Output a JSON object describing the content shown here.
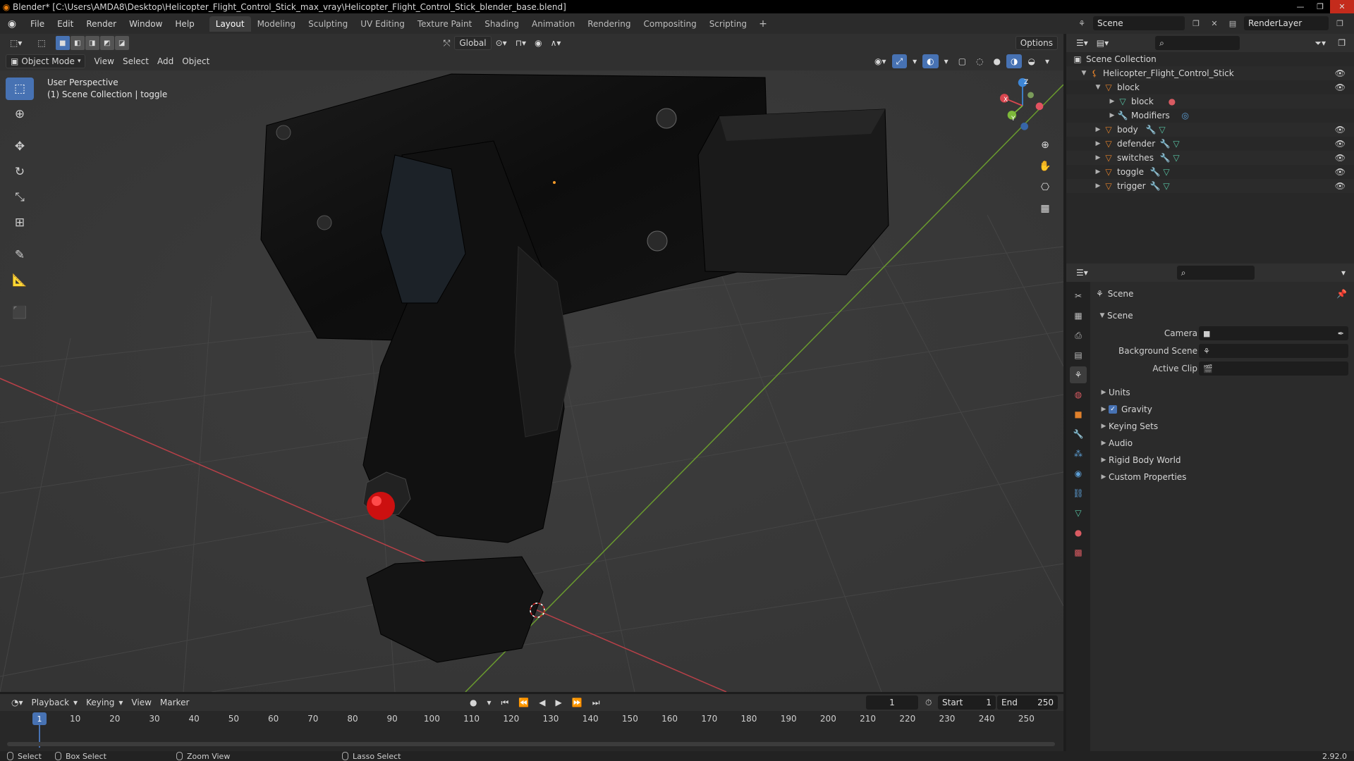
{
  "window": {
    "title": "Blender* [C:\\Users\\AMDA8\\Desktop\\Helicopter_Flight_Control_Stick_max_vray\\Helicopter_Flight_Control_Stick_blender_base.blend]",
    "minimize": "—",
    "maximize": "❐",
    "close": "✕"
  },
  "menubar": {
    "items": [
      "File",
      "Edit",
      "Render",
      "Window",
      "Help"
    ],
    "workspaces": [
      "Layout",
      "Modeling",
      "Sculpting",
      "UV Editing",
      "Texture Paint",
      "Shading",
      "Animation",
      "Rendering",
      "Compositing",
      "Scripting"
    ],
    "active_workspace": "Layout",
    "add_workspace": "+",
    "scene": "Scene",
    "view_layer": "RenderLayer"
  },
  "viewport_header": {
    "transform_orientation": "Global",
    "options": "Options",
    "mode": "Object Mode",
    "menus": [
      "View",
      "Select",
      "Add",
      "Object"
    ]
  },
  "viewport": {
    "perspective": "User Perspective",
    "collection_info": "(1) Scene Collection | toggle",
    "gizmo": {
      "x": "X",
      "y": "Y",
      "z": "Z"
    }
  },
  "outliner": {
    "root": "Scene Collection",
    "collection": "Helicopter_Flight_Control_Stick",
    "rows": [
      {
        "label": "block",
        "type": "object",
        "depth": 2,
        "expanded": true
      },
      {
        "label": "block",
        "type": "mesh",
        "depth": 3
      },
      {
        "label": "Modifiers",
        "type": "modifiers",
        "depth": 3
      },
      {
        "label": "body",
        "type": "object",
        "depth": 2
      },
      {
        "label": "defender",
        "type": "object",
        "depth": 2
      },
      {
        "label": "switches",
        "type": "object",
        "depth": 2
      },
      {
        "label": "toggle",
        "type": "object",
        "depth": 2
      },
      {
        "label": "trigger",
        "type": "object",
        "depth": 2
      }
    ]
  },
  "properties": {
    "context": "Scene",
    "section": "Scene",
    "fields": [
      {
        "label": "Camera",
        "value": ""
      },
      {
        "label": "Background Scene",
        "value": ""
      },
      {
        "label": "Active Clip",
        "value": ""
      }
    ],
    "panels": [
      "Units",
      "Gravity",
      "Keying Sets",
      "Audio",
      "Rigid Body World",
      "Custom Properties"
    ],
    "gravity_checked": true
  },
  "timeline": {
    "menus": [
      "Playback",
      "Keying",
      "View",
      "Marker"
    ],
    "current_frame": "1",
    "start_label": "Start",
    "start": "1",
    "end_label": "End",
    "end": "250",
    "ticks": [
      "10",
      "20",
      "30",
      "40",
      "50",
      "60",
      "70",
      "80",
      "90",
      "100",
      "110",
      "120",
      "130",
      "140",
      "150",
      "160",
      "170",
      "180",
      "190",
      "200",
      "210",
      "220",
      "230",
      "240",
      "250"
    ],
    "playhead": "1"
  },
  "statusbar": {
    "select": "Select",
    "box_select": "Box Select",
    "zoom_view": "Zoom View",
    "lasso_select": "Lasso Select",
    "version": "2.92.0"
  },
  "colors": {
    "accent": "#4772b3",
    "object_icon": "#e0802b",
    "mesh_icon": "#57c4a4",
    "x_axis": "#d9464f",
    "y_axis": "#7db93a",
    "z_axis": "#3d86d6"
  }
}
